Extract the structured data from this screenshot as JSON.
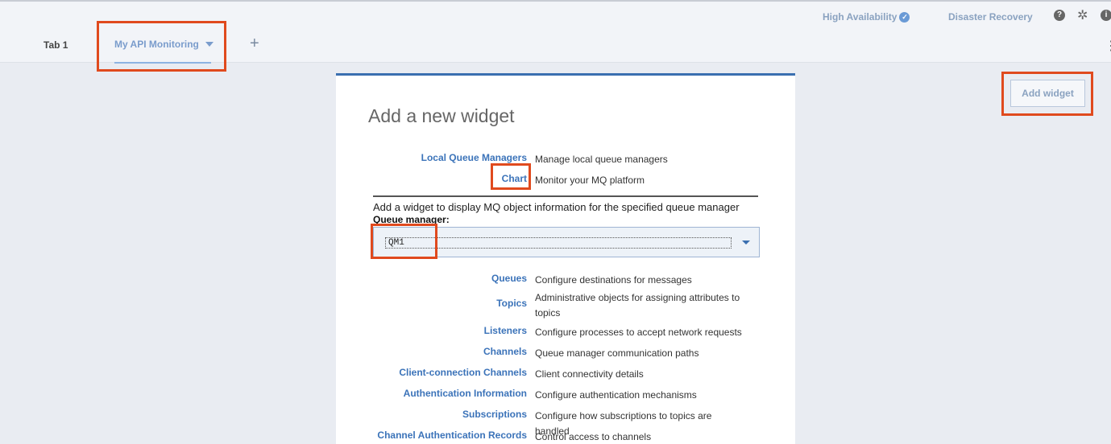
{
  "header": {
    "high_availability": "High Availability",
    "disaster_recovery": "Disaster Recovery",
    "help_icon": "?",
    "info_icon": "i"
  },
  "tabs": {
    "tab1": "Tab 1",
    "active": "My API Monitoring",
    "add": "+"
  },
  "toolbar": {
    "add_widget": "Add widget"
  },
  "panel": {
    "title": "Add a new widget",
    "top_items": [
      {
        "label": "Local Queue Managers",
        "desc": "Manage local queue managers"
      },
      {
        "label": "Chart",
        "desc": "Monitor your MQ platform"
      }
    ],
    "qm_heading": "Add a widget to display MQ object information for the specified queue manager",
    "qm_label": "Queue manager:",
    "qm_selected": "QM1",
    "object_items": [
      {
        "label": "Queues",
        "desc": "Configure destinations for messages"
      },
      {
        "label": "Topics",
        "desc": "Administrative objects for assigning attributes to topics"
      },
      {
        "label": "Listeners",
        "desc": "Configure processes to accept network requests"
      },
      {
        "label": "Channels",
        "desc": "Queue manager communication paths"
      },
      {
        "label": "Client-connection Channels",
        "desc": "Client connectivity details"
      },
      {
        "label": "Authentication Information",
        "desc": "Configure authentication mechanisms"
      },
      {
        "label": "Subscriptions",
        "desc": "Configure how subscriptions to topics are handled"
      },
      {
        "label": "Channel Authentication Records",
        "desc": "Control access to channels"
      }
    ]
  },
  "colors": {
    "accent": "#3b73b9",
    "highlight": "#e04a1e"
  }
}
